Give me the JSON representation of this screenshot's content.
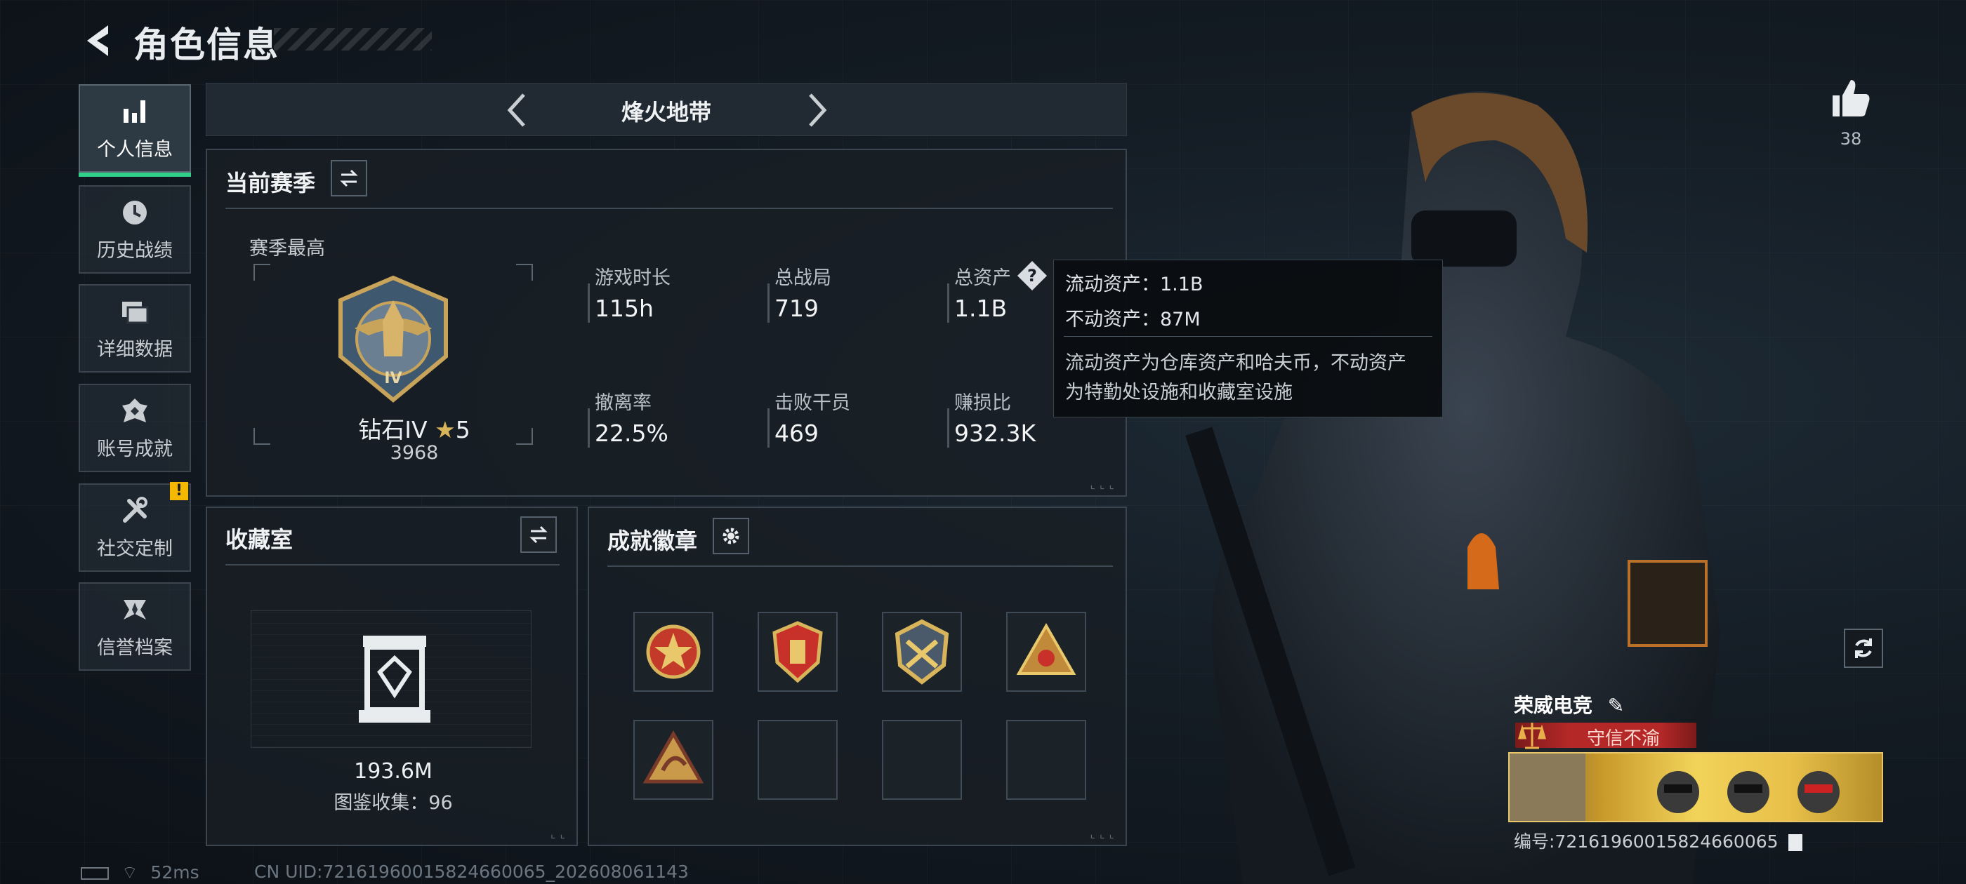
{
  "header": {
    "title": "角色信息"
  },
  "sidebar": {
    "items": [
      {
        "label": "个人信息",
        "icon": "bar-chart-icon",
        "active": true
      },
      {
        "label": "历史战绩",
        "icon": "history-clock-icon"
      },
      {
        "label": "详细数据",
        "icon": "folders-icon"
      },
      {
        "label": "账号成就",
        "icon": "achievement-icon"
      },
      {
        "label": "社交定制",
        "icon": "tools-icon",
        "badge": "!"
      },
      {
        "label": "信誉档案",
        "icon": "credit-icon"
      }
    ]
  },
  "mode": {
    "title": "烽火地带"
  },
  "season": {
    "title": "当前赛季",
    "best_label": "赛季最高",
    "rank": "钻石IV",
    "stars": "5",
    "score": "3968",
    "stats": [
      {
        "label": "游戏时长",
        "value": "115h"
      },
      {
        "label": "总战局",
        "value": "719"
      },
      {
        "label": "总资产",
        "value": "1.1B"
      },
      {
        "label": "撤离率",
        "value": "22.5%"
      },
      {
        "label": "击败干员",
        "value": "469"
      },
      {
        "label": "赚损比",
        "value": "932.3K"
      }
    ]
  },
  "tooltip": {
    "line1": "流动资产：1.1B",
    "line2": "不动资产：87M",
    "desc1": "流动资产为仓库资产和哈夫币，不动资产",
    "desc2": "为特勤处设施和收藏室设施"
  },
  "collection": {
    "title": "收藏室",
    "value": "193.6M",
    "catalog": "图鉴收集：96"
  },
  "badges": {
    "title": "成就徽章",
    "slots": [
      {
        "filled": true,
        "color": "#c43a2a"
      },
      {
        "filled": true,
        "color": "#c8302a"
      },
      {
        "filled": true,
        "color": "#b89038"
      },
      {
        "filled": true,
        "color": "#c08a3a"
      },
      {
        "filled": true,
        "color": "#c89a4a"
      },
      {
        "filled": false
      },
      {
        "filled": false
      },
      {
        "filled": false
      }
    ]
  },
  "status": {
    "ping": "52ms",
    "uid": "CN UID:72161960015824660065_202608061143"
  },
  "profile": {
    "likes": "38",
    "team": "荣威电竞",
    "honor": "守信不渝",
    "player_id": "编号:72161960015824660065"
  },
  "colors": {
    "accent": "#2fd08a",
    "warn": "#f5b800",
    "honor": "#b52828"
  }
}
